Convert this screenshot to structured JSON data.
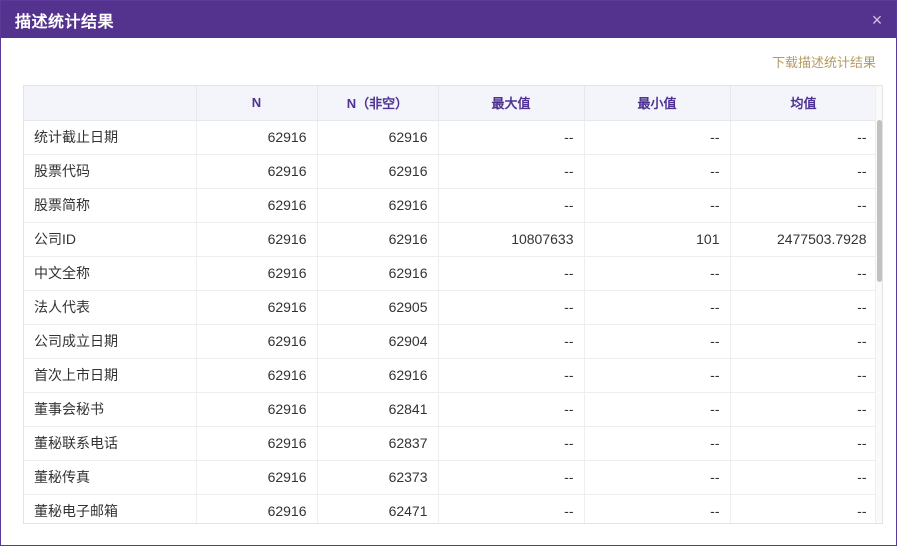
{
  "dialog": {
    "title": "描述统计结果",
    "close_symbol": "×",
    "download_label": "下载描述统计结果"
  },
  "table": {
    "headers": [
      "",
      "N",
      "N（非空）",
      "最大值",
      "最小值",
      "均值"
    ],
    "rows": [
      [
        "统计截止日期",
        "62916",
        "62916",
        "--",
        "--",
        "--"
      ],
      [
        "股票代码",
        "62916",
        "62916",
        "--",
        "--",
        "--"
      ],
      [
        "股票简称",
        "62916",
        "62916",
        "--",
        "--",
        "--"
      ],
      [
        "公司ID",
        "62916",
        "62916",
        "10807633",
        "101",
        "2477503.7928"
      ],
      [
        "中文全称",
        "62916",
        "62916",
        "--",
        "--",
        "--"
      ],
      [
        "法人代表",
        "62916",
        "62905",
        "--",
        "--",
        "--"
      ],
      [
        "公司成立日期",
        "62916",
        "62904",
        "--",
        "--",
        "--"
      ],
      [
        "首次上市日期",
        "62916",
        "62916",
        "--",
        "--",
        "--"
      ],
      [
        "董事会秘书",
        "62916",
        "62841",
        "--",
        "--",
        "--"
      ],
      [
        "董秘联系电话",
        "62916",
        "62837",
        "--",
        "--",
        "--"
      ],
      [
        "董秘传真",
        "62916",
        "62373",
        "--",
        "--",
        "--"
      ],
      [
        "董秘电子邮箱",
        "62916",
        "62471",
        "--",
        "--",
        "--"
      ]
    ]
  },
  "icons": {
    "close": "close-icon"
  }
}
